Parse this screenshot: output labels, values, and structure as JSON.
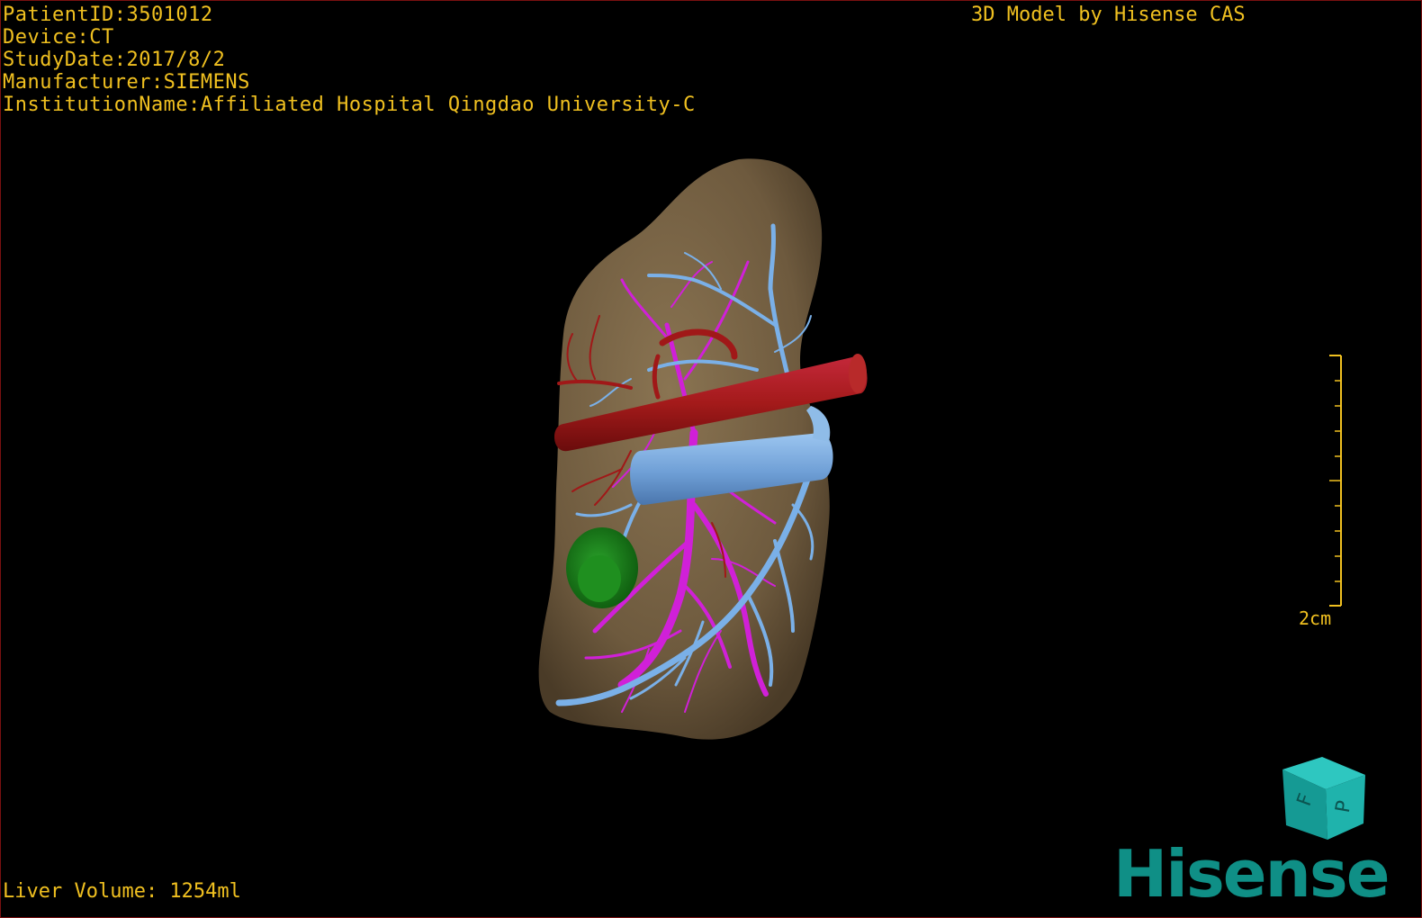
{
  "dicom_overlay": {
    "patient_id": "PatientID:3501012",
    "device": "Device:CT",
    "study_date": "StudyDate:2017/8/2",
    "manufacturer": "Manufacturer:SIEMENS",
    "institution": "InstitutionName:Affiliated Hospital Qingdao University-C"
  },
  "watermark": "3D Model by Hisense CAS",
  "scale_bar": {
    "label": "2cm"
  },
  "stats": {
    "liver_volume": "Liver Volume: 1254ml"
  },
  "orientation_cube": {
    "face_front": "F",
    "face_side": "P"
  },
  "brand_logo": "Hisense",
  "colors": {
    "overlay_text": "#f0c020",
    "liver": "#7a6545",
    "artery_red": "#a01818",
    "portal_vein_blue": "#74a6dc",
    "hepatic_vein_magenta": "#d020d8",
    "lesion_green": "#1a8a1a",
    "brand_teal": "#0f8f86"
  }
}
